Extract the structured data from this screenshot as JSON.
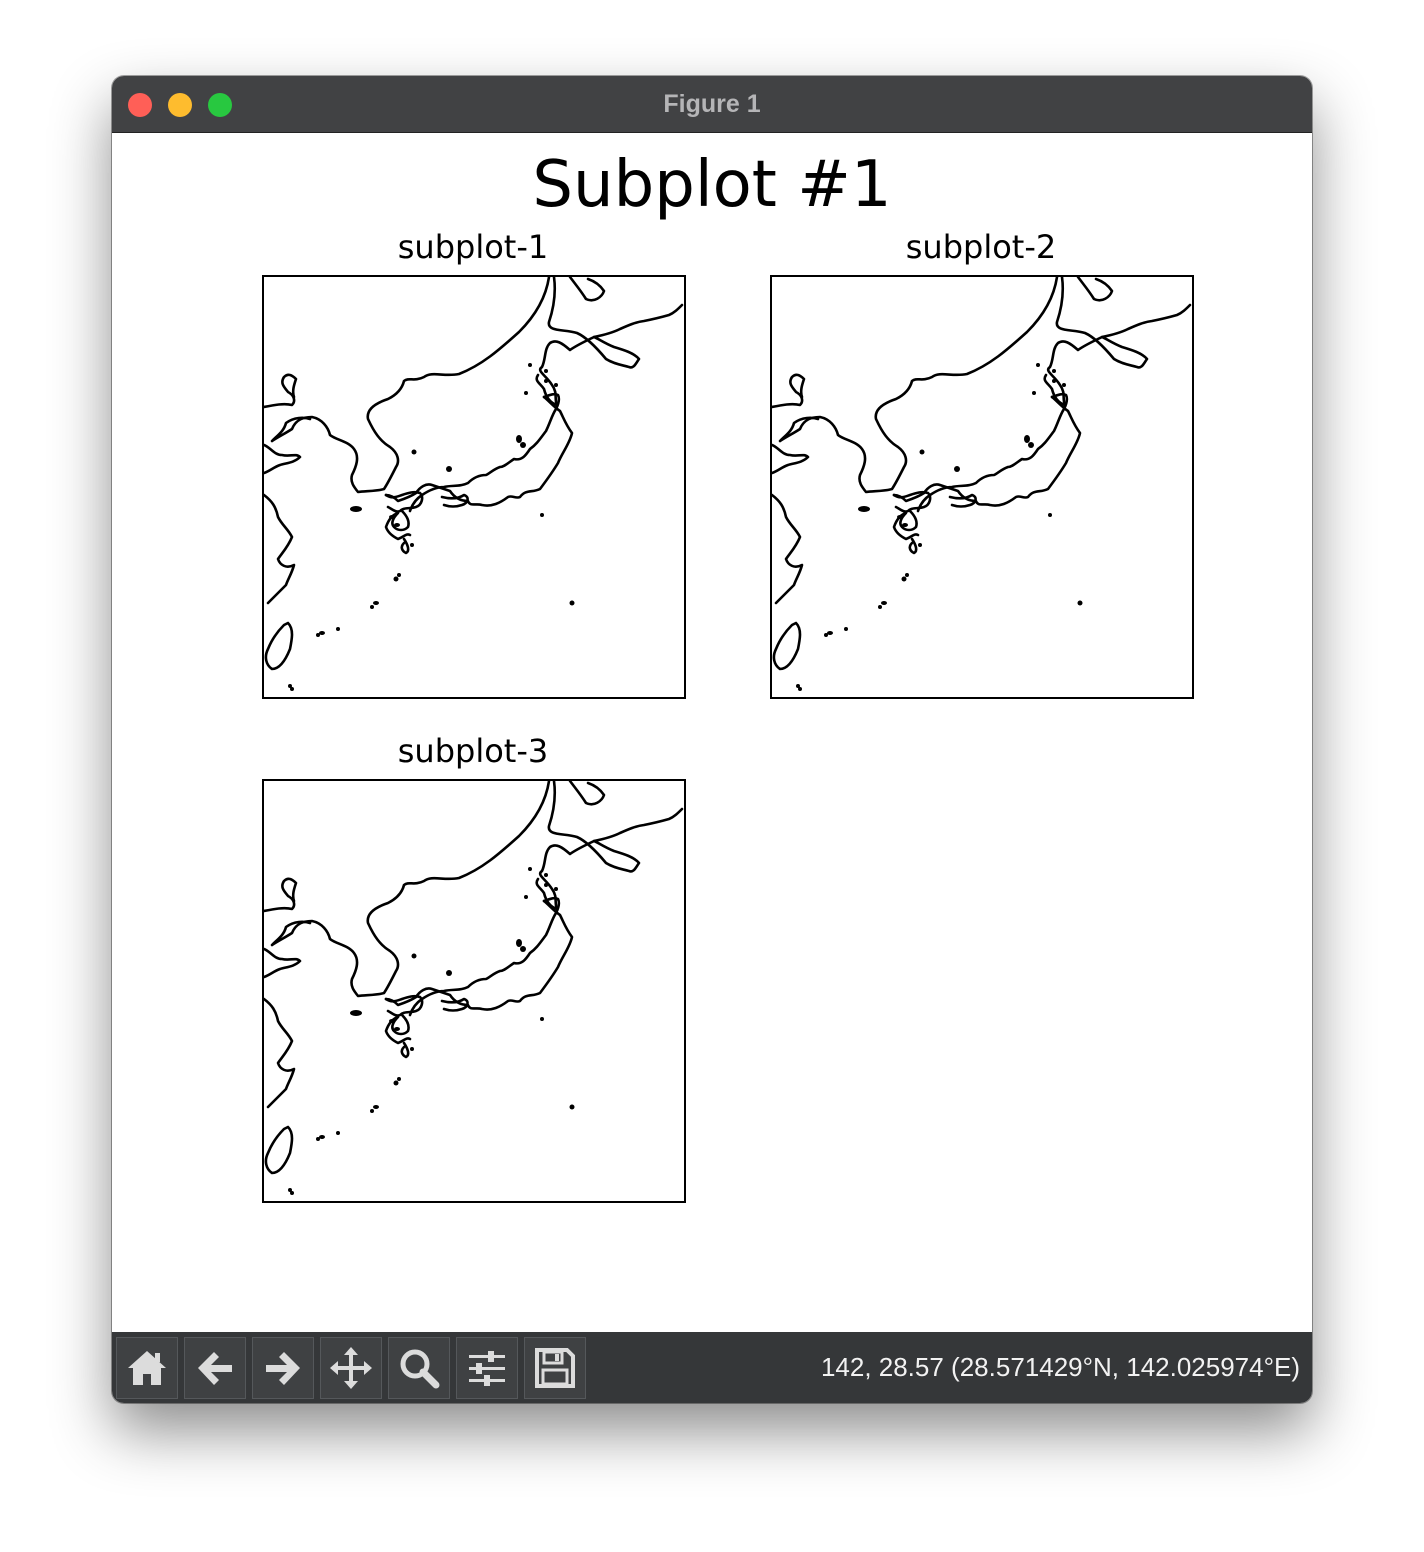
{
  "window": {
    "title": "Figure 1",
    "traffic_lights": {
      "close": "#ff5f57",
      "minimize": "#febc2e",
      "zoom": "#28c840"
    }
  },
  "figure": {
    "suptitle": "Subplot #1",
    "subplots": [
      {
        "title": "subplot-1",
        "content": "coastline map of Japan, Korea and East China coast"
      },
      {
        "title": "subplot-2",
        "content": "coastline map of Japan, Korea and East China coast"
      },
      {
        "title": "subplot-3",
        "content": "coastline map of Japan, Korea and East China coast"
      }
    ]
  },
  "toolbar": {
    "buttons": [
      {
        "icon": "home-icon",
        "action": "home"
      },
      {
        "icon": "arrow-left-icon",
        "action": "back"
      },
      {
        "icon": "arrow-right-icon",
        "action": "forward"
      },
      {
        "icon": "move-icon",
        "action": "pan"
      },
      {
        "icon": "magnifier-icon",
        "action": "zoom"
      },
      {
        "icon": "sliders-icon",
        "action": "configure-subplots"
      },
      {
        "icon": "floppy-disk-icon",
        "action": "save"
      }
    ],
    "coordinates": "142, 28.57 (28.571429°N, 142.025974°E)"
  }
}
